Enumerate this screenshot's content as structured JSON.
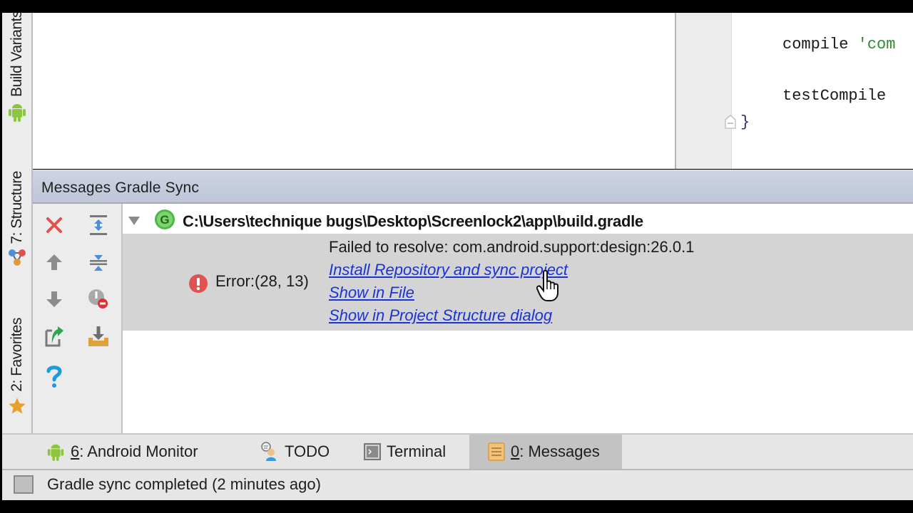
{
  "left_strip": {
    "tabs": [
      {
        "label": "Build Variants",
        "icon": "android-icon"
      },
      {
        "label": "7: Structure",
        "icon": "structure-icon"
      },
      {
        "label": "2: Favorites",
        "icon": "star-icon"
      }
    ]
  },
  "editor": {
    "lines": [
      {
        "keyword": "compile ",
        "string": "'com"
      },
      {
        "keyword": "testCompile ",
        "string": ""
      },
      {
        "keyword": "}",
        "string": ""
      }
    ]
  },
  "panel": {
    "title": "Messages Gradle Sync",
    "toolbar": [
      {
        "name": "close",
        "icon": "close-icon"
      },
      {
        "name": "expand-all",
        "icon": "expand-all-icon"
      },
      {
        "name": "previous",
        "icon": "arrow-up-icon"
      },
      {
        "name": "collapse-all",
        "icon": "collapse-all-icon"
      },
      {
        "name": "next",
        "icon": "arrow-down-icon"
      },
      {
        "name": "hide-warnings",
        "icon": "hide-warnings-icon"
      },
      {
        "name": "export",
        "icon": "export-icon"
      },
      {
        "name": "autoscroll",
        "icon": "scroll-down-icon"
      },
      {
        "name": "help",
        "icon": "help-icon"
      }
    ],
    "tree": {
      "root_path": "C:\\Users\\technique bugs\\Desktop\\Screenlock2\\app\\build.gradle",
      "error": {
        "location": "Error:(28, 13)",
        "message": "Failed to resolve: com.android.support:design:26.0.1",
        "links": [
          "Install Repository and sync project",
          "Show in File",
          "Show in Project Structure dialog"
        ]
      }
    }
  },
  "bottom_tabs": [
    {
      "mnemonic": "6",
      "label": ": Android Monitor",
      "icon": "android-icon",
      "active": false
    },
    {
      "mnemonic": "",
      "label": "TODO",
      "icon": "todo-icon",
      "active": false
    },
    {
      "mnemonic": "",
      "label": "Terminal",
      "icon": "terminal-icon",
      "active": false
    },
    {
      "mnemonic": "0",
      "label": ": Messages",
      "icon": "messages-icon",
      "active": true
    }
  ],
  "status_bar": {
    "text": "Gradle sync completed (2 minutes ago)"
  },
  "colors": {
    "link": "#1a33d6",
    "error": "#e0524f",
    "gradle_green": "#4cb848",
    "android_green": "#8cc63f",
    "header_bg": "#c5ccdd"
  }
}
